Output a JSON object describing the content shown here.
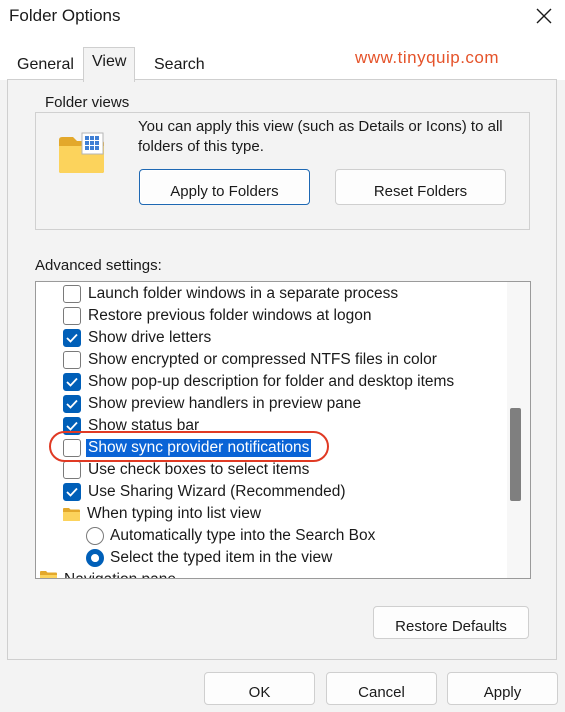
{
  "window": {
    "title": "Folder Options"
  },
  "tabs": [
    {
      "label": "General",
      "active": false
    },
    {
      "label": "View",
      "active": true
    },
    {
      "label": "Search",
      "active": false
    }
  ],
  "watermark": "www.tinyquip.com",
  "folder_views": {
    "title": "Folder views",
    "description": "You can apply this view (such as Details or Icons) to all folders of this type.",
    "apply_label": "Apply to Folders",
    "reset_label": "Reset Folders"
  },
  "advanced": {
    "label": "Advanced settings:",
    "items": [
      {
        "type": "checkbox",
        "label": "Launch folder windows in a separate process",
        "checked": false
      },
      {
        "type": "checkbox",
        "label": "Restore previous folder windows at logon",
        "checked": false
      },
      {
        "type": "checkbox",
        "label": "Show drive letters",
        "checked": true
      },
      {
        "type": "checkbox",
        "label": "Show encrypted or compressed NTFS files in color",
        "checked": false
      },
      {
        "type": "checkbox",
        "label": "Show pop-up description for folder and desktop items",
        "checked": true
      },
      {
        "type": "checkbox",
        "label": "Show preview handlers in preview pane",
        "checked": true
      },
      {
        "type": "checkbox",
        "label": "Show status bar",
        "checked": true
      },
      {
        "type": "checkbox",
        "label": "Show sync provider notifications",
        "checked": false,
        "selected": true
      },
      {
        "type": "checkbox",
        "label": "Use check boxes to select items",
        "checked": false
      },
      {
        "type": "checkbox",
        "label": "Use Sharing Wizard (Recommended)",
        "checked": true
      },
      {
        "type": "folder",
        "label": "When typing into list view"
      },
      {
        "type": "radio",
        "label": "Automatically type into the Search Box",
        "checked": false
      },
      {
        "type": "radio",
        "label": "Select the typed item in the view",
        "checked": true
      },
      {
        "type": "folder",
        "label": "Navigation pane"
      }
    ],
    "restore_defaults_label": "Restore Defaults"
  },
  "footer": {
    "ok_label": "OK",
    "cancel_label": "Cancel",
    "apply_label": "Apply"
  },
  "colors": {
    "accent": "#005fb8",
    "selection": "#0a64d6",
    "annotation": "#e03a24",
    "watermark": "#e5532a"
  }
}
